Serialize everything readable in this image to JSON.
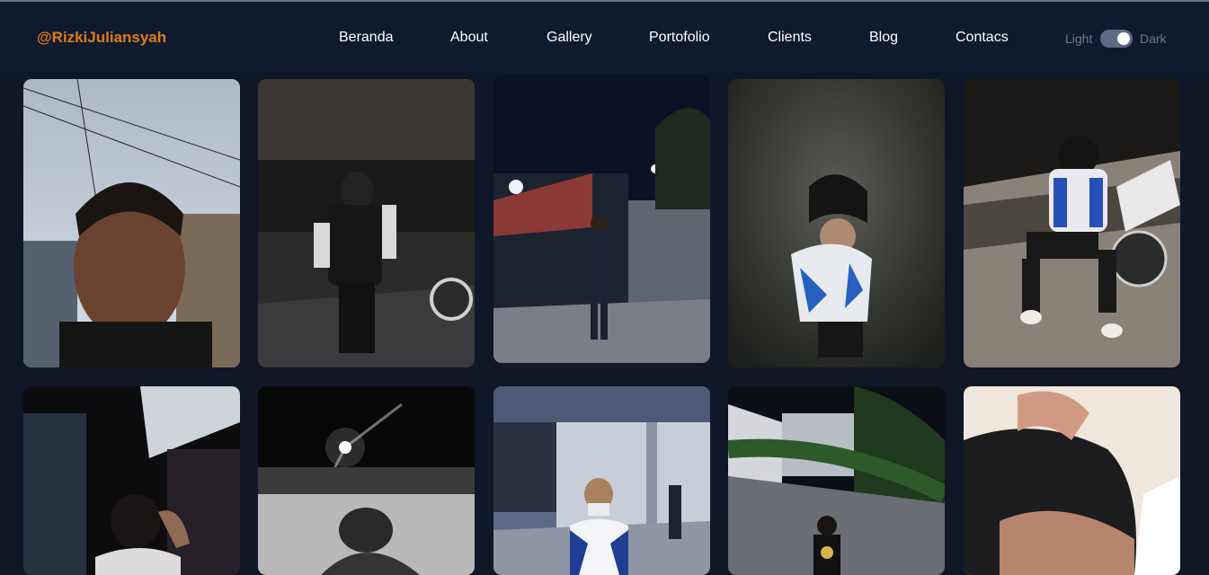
{
  "brand": "@RizkiJuliansyah",
  "nav": {
    "items": [
      "Beranda",
      "About",
      "Gallery",
      "Portofolio",
      "Clients",
      "Blog",
      "Contacs"
    ]
  },
  "theme": {
    "light_label": "Light",
    "dark_label": "Dark",
    "mode": "dark"
  },
  "gallery": {
    "photos": [
      {
        "subject": "selfie under power lines at dusk"
      },
      {
        "subject": "person in hoodie facing a wall at night"
      },
      {
        "subject": "person standing by gate at night"
      },
      {
        "subject": "person in racing jacket looking down"
      },
      {
        "subject": "person sitting by motorbike at night"
      },
      {
        "subject": "person adjusting hair under awning"
      },
      {
        "subject": "black and white night photo with street light"
      },
      {
        "subject": "person wearing mask in parking area"
      },
      {
        "subject": "person walking along wall at night"
      },
      {
        "subject": "close up of person touching hair"
      }
    ]
  }
}
